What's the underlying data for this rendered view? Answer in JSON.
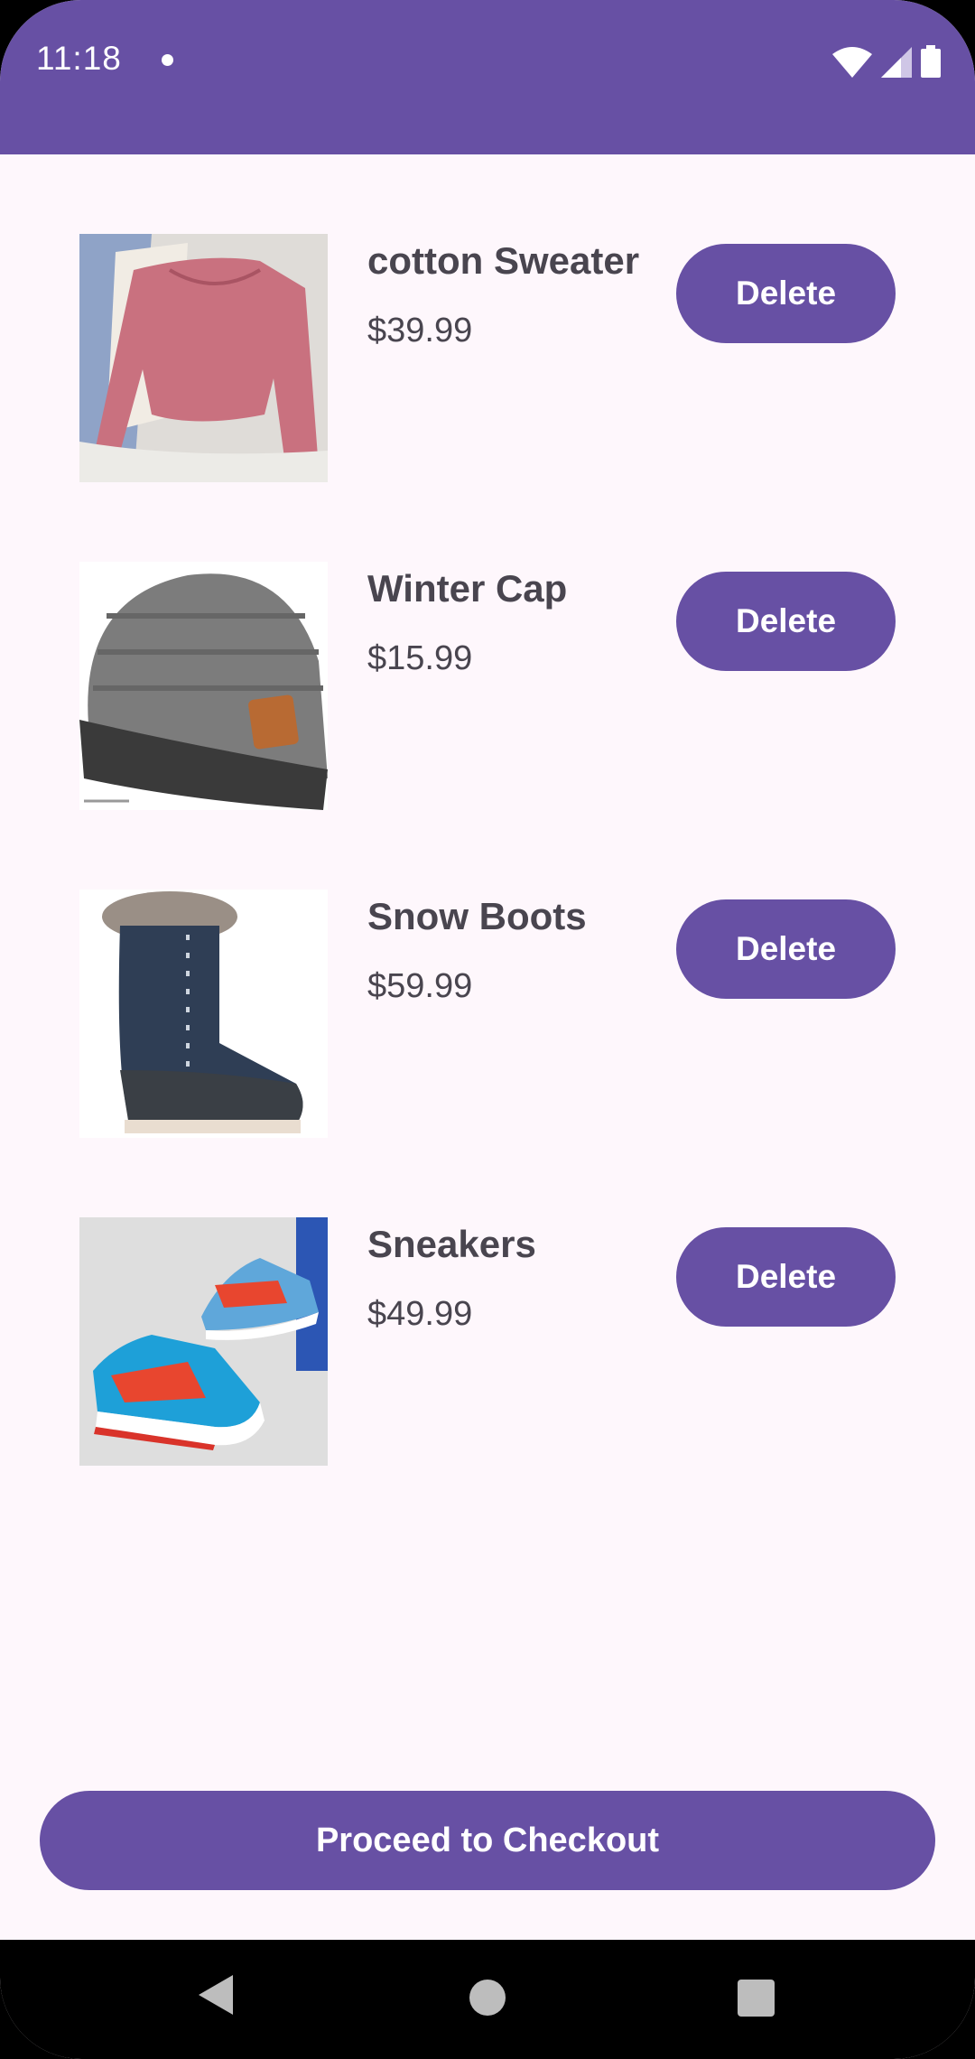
{
  "status_bar": {
    "time": "11:18",
    "icons": [
      "wifi-icon",
      "cellular-signal-icon",
      "battery-icon"
    ]
  },
  "cart": {
    "items": [
      {
        "name": "cotton Sweater",
        "price": "$39.99",
        "delete_label": "Delete",
        "image": "sweater-image"
      },
      {
        "name": "Winter Cap",
        "price": "$15.99",
        "delete_label": "Delete",
        "image": "cap-image"
      },
      {
        "name": "Snow Boots",
        "price": "$59.99",
        "delete_label": "Delete",
        "image": "boot-image"
      },
      {
        "name": "Sneakers",
        "price": "$49.99",
        "delete_label": "Delete",
        "image": "sneakers-image"
      }
    ],
    "checkout_label": "Proceed to Checkout"
  },
  "colors": {
    "primary": "#6750A4",
    "background": "#FEF7FC",
    "text": "#49454F"
  },
  "nav_bar": {
    "icons": [
      "back-icon",
      "home-icon",
      "recents-icon"
    ]
  }
}
